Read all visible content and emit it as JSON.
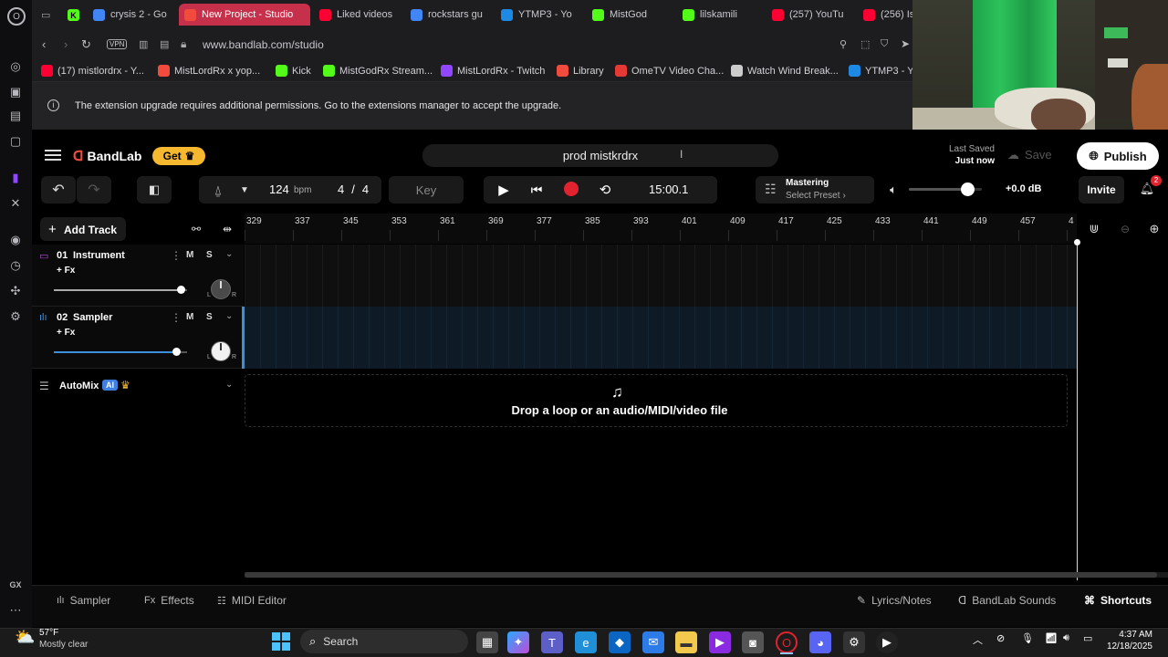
{
  "browser": {
    "tabs": [
      {
        "label": "crysis 2 - Go",
        "icon": "google-icon",
        "color": "#4285f4"
      },
      {
        "label": "New Project - Studio",
        "icon": "bandlab-icon",
        "color": "#f04b3c",
        "active": true
      },
      {
        "label": "Liked videos",
        "icon": "youtube-icon",
        "color": "#ff0033"
      },
      {
        "label": "rockstars gu",
        "icon": "google-icon",
        "color": "#4285f4"
      },
      {
        "label": "YTMP3 - Yo",
        "icon": "ytmp3-icon",
        "color": "#1e88e5"
      },
      {
        "label": "MistGod",
        "icon": "kick-icon",
        "color": "#53fc18"
      },
      {
        "label": "lilskamili",
        "icon": "kick-icon",
        "color": "#53fc18"
      },
      {
        "label": "(257) YouTu",
        "icon": "youtube-icon",
        "color": "#ff0033"
      },
      {
        "label": "(256) Is",
        "icon": "youtube-icon",
        "color": "#ff0033"
      }
    ],
    "vpn_label": "VPN",
    "url": "www.bandlab.com/studio",
    "bookmarks": [
      {
        "label": "(17) mistlordrx - Y...",
        "color": "#ff0033"
      },
      {
        "label": "MistLordRx x yop...",
        "color": "#f04b3c"
      },
      {
        "label": "Kick",
        "color": "#53fc18"
      },
      {
        "label": "MistGodRx Stream...",
        "color": "#53fc18"
      },
      {
        "label": "MistLordRx - Twitch",
        "color": "#9146ff"
      },
      {
        "label": "Library",
        "color": "#f04b3c"
      },
      {
        "label": "OmeTV Video Cha...",
        "color": "#e53935"
      },
      {
        "label": "Watch Wind Break...",
        "color": "#cccccc"
      },
      {
        "label": "YTMP3 - Yo",
        "color": "#1e88e5"
      }
    ],
    "notice": "The extension upgrade requires additional permissions. Go to the extensions manager to accept the upgrade."
  },
  "opera_sidebar": {
    "gx_label": "GX"
  },
  "studio": {
    "brand": "BandLab",
    "get_label": "Get",
    "project_name": "prod mistkrdrx",
    "last_saved_label": "Last Saved",
    "last_saved_value": "Just now",
    "save_label": "Save",
    "publish_label": "Publish",
    "tempo": "124",
    "tempo_unit": "bpm",
    "time_sig_num": "4",
    "time_sig_sep": "/",
    "time_sig_den": "4",
    "key_label": "Key",
    "time_display": "15:00.1",
    "mastering_title": "Mastering",
    "mastering_sub": "Select Preset",
    "volume_db": "+0.0 dB",
    "master_volume_level": 0.8,
    "invite_label": "Invite",
    "notification_count": "2",
    "add_track_label": "Add Track",
    "ruler": [
      "329",
      "337",
      "345",
      "353",
      "361",
      "369",
      "377",
      "385",
      "393",
      "401",
      "409",
      "417",
      "425",
      "433",
      "441",
      "449",
      "457",
      "4"
    ],
    "tracks": [
      {
        "num": "01",
        "name": "Instrument",
        "fx": "+ Fx",
        "mute": "M",
        "solo": "S",
        "volume_level": 0.95
      },
      {
        "num": "02",
        "name": "Sampler",
        "fx": "+ Fx",
        "mute": "M",
        "solo": "S",
        "volume_level": 0.92
      }
    ],
    "pan_l": "L",
    "pan_r": "R",
    "automix_label": "AutoMix",
    "ai_badge": "AI",
    "drop_text": "Drop a loop or an audio/MIDI/video file",
    "bottom_left": [
      {
        "label": "Sampler",
        "icon": "waveform-icon"
      },
      {
        "label": "Effects",
        "icon": "fx-icon"
      },
      {
        "label": "MIDI Editor",
        "icon": "midi-icon"
      }
    ],
    "bottom_right": [
      {
        "label": "Lyrics/Notes",
        "icon": "pen-icon"
      },
      {
        "label": "BandLab Sounds",
        "icon": "bandlab-sounds-icon"
      },
      {
        "label": "Shortcuts",
        "icon": "shortcuts-icon"
      }
    ]
  },
  "taskbar": {
    "weather_temp": "57°F",
    "weather_desc": "Mostly clear",
    "search_label": "Search",
    "time": "4:37 AM",
    "date": "12/18/2025"
  },
  "colors": {
    "bandlab_red": "#f04b3c",
    "get_yellow": "#f5b82e",
    "sampler_track": "#0e1a25",
    "active_tab": "#c7304a"
  }
}
